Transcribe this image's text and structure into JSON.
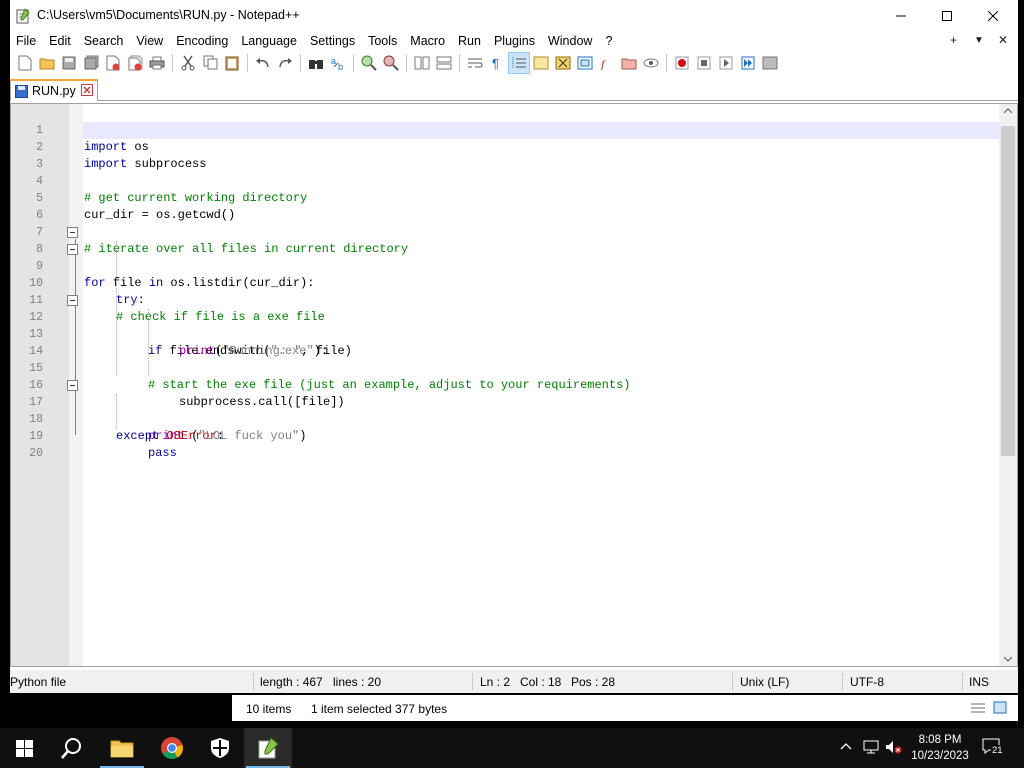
{
  "window": {
    "title": "C:\\Users\\vm5\\Documents\\RUN.py - Notepad++"
  },
  "menu": [
    "File",
    "Edit",
    "Search",
    "View",
    "Encoding",
    "Language",
    "Settings",
    "Tools",
    "Macro",
    "Run",
    "Plugins",
    "Window",
    "?"
  ],
  "menu_right": {
    "plus": "+",
    "dropdown": "▼",
    "close": "✕"
  },
  "tab": {
    "label": "RUN.py"
  },
  "editor": {
    "current_line": 2,
    "lines": [
      {
        "n": "1"
      },
      {
        "n": "2"
      },
      {
        "n": "3"
      },
      {
        "n": "4"
      },
      {
        "n": "5"
      },
      {
        "n": "6"
      },
      {
        "n": "7"
      },
      {
        "n": "8"
      },
      {
        "n": "9"
      },
      {
        "n": "10"
      },
      {
        "n": "11"
      },
      {
        "n": "12"
      },
      {
        "n": "13"
      },
      {
        "n": "14"
      },
      {
        "n": "15"
      },
      {
        "n": "16"
      },
      {
        "n": "17"
      },
      {
        "n": "18"
      },
      {
        "n": "19"
      },
      {
        "n": "20"
      }
    ],
    "code": {
      "l1_kw": "import",
      "l1_rest": " os",
      "l2_kw": "import",
      "l2_rest": " subprocess",
      "l4": "# get current working directory",
      "l5": "cur_dir = os.getcwd()",
      "l7": "# iterate over all files in current directory",
      "l8_kw": "for",
      "l8_a": " file ",
      "l8_kw2": "in",
      "l8_b": " os.listdir(cur_dir):",
      "l9_kw": "try",
      "l9_b": ":",
      "l11": "# check if file is a exe file",
      "l12_kw": "if",
      "l12_a": " file.endswith(",
      "l12_str": "\".exe\"",
      "l12_b": "):",
      "l13_kw": "print",
      "l13_a": "(",
      "l13_str": "\"Running: \"",
      "l13_b": ", file)",
      "l15": "# start the exe file (just an example, adjust to your requirements)",
      "l16": "subprocess.call([file])",
      "l17_kw": "except",
      "l17_cls": " OSError",
      "l17_b": ":",
      "l18_kw": "print",
      "l18_a": " (",
      "l18_str": "\"LOL fuck you\"",
      "l18_b": ")",
      "l19_kw": "pass"
    }
  },
  "statusbar": {
    "filetype": "Python file",
    "length": "length : 467",
    "lines": "lines : 20",
    "ln": "Ln : 2",
    "col": "Col : 18",
    "pos": "Pos : 28",
    "eol": "Unix (LF)",
    "encoding": "UTF-8",
    "mode": "INS"
  },
  "explorer": {
    "items": "10 items",
    "selected": "1 item selected  377 bytes"
  },
  "taskbar": {
    "time": "8:08 PM",
    "date": "10/23/2023",
    "notifications": "21"
  },
  "colors": {
    "tab_accent": "#f9a534",
    "current_line": "#e8e8ff",
    "keyword": "#00009c",
    "comment": "#008000",
    "taskbar": "#101010"
  }
}
